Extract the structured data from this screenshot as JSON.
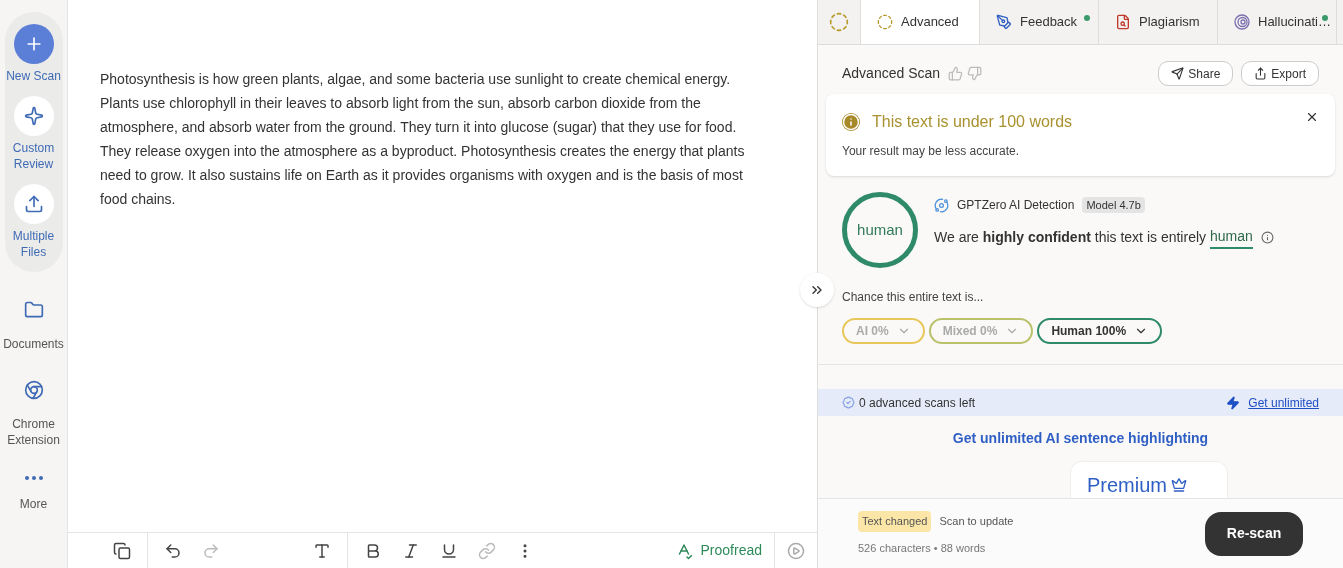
{
  "sidebar": {
    "actions": [
      {
        "label": "New Scan",
        "kind": "plus",
        "primary": true
      },
      {
        "label": "Custom Review",
        "kind": "sparkle",
        "primary": false
      },
      {
        "label": "Multiple Files",
        "kind": "upload",
        "primary": false
      }
    ],
    "links": [
      {
        "label": "Documents",
        "kind": "folder"
      },
      {
        "label": "Chrome Extension",
        "kind": "chrome"
      },
      {
        "label": "More",
        "kind": "dots"
      }
    ]
  },
  "editor": {
    "text": "Photosynthesis is how green plants, algae, and some bacteria use sunlight to create chemical energy. Plants use chlorophyll in their leaves to absorb light from the sun, absorb carbon dioxide from the atmosphere, and absorb water from the ground. They turn it into glucose (sugar) that they use for food. They release oxygen into the atmosphere as a byproduct. Photosynthesis creates the energy that plants need to grow. It also sustains life on Earth as it provides organisms with oxygen and is the basis of most food chains.",
    "toolbar": {
      "redo_disabled": true,
      "proofread": "Proofread"
    }
  },
  "tabs": [
    {
      "label": "Advanced",
      "kind": "advanced",
      "selected": true,
      "dot": false
    },
    {
      "label": "Feedback",
      "kind": "feedback",
      "selected": false,
      "dot": true
    },
    {
      "label": "Plagiarism",
      "kind": "plagiarism",
      "selected": false,
      "dot": false
    },
    {
      "label": "Hallucinati…",
      "kind": "hallucination",
      "selected": false,
      "dot": true
    }
  ],
  "panel": {
    "title": "Advanced Scan",
    "buttons": [
      "Share",
      "Export"
    ],
    "alert": {
      "title": "This text is under 100 words",
      "message": "Your result may be less accurate."
    },
    "result": {
      "verdict": "human",
      "source": "GPTZero AI Detection",
      "model": "Model 4.7b",
      "statement": "We are **highly confident** this text is entirely",
      "statement_word": "human"
    },
    "chance_label": "Chance this entire text is...",
    "chances": [
      {
        "label": "AI 0%",
        "color": "#e8c75a",
        "selected": false
      },
      {
        "label": "Mixed 0%",
        "color": "#b9c26a",
        "selected": false
      },
      {
        "label": "Human 100%",
        "color": "#2f8a6a",
        "selected": true
      }
    ],
    "scans_left": "0 advanced scans left",
    "get_unlimited": "Get unlimited",
    "promo": "Get unlimited AI sentence highlighting",
    "premium": "Premium"
  },
  "footer": {
    "badge": "Text changed",
    "hint": "Scan to update",
    "stats": "526 characters • 88 words",
    "button": "Re-scan"
  }
}
